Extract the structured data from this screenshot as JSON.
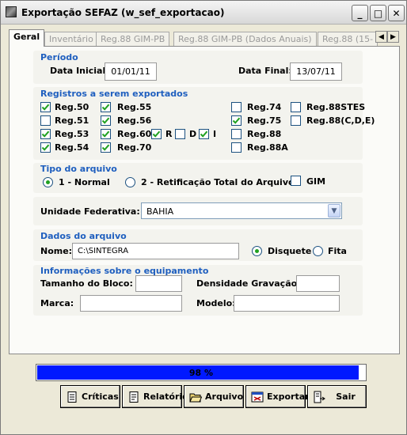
{
  "window": {
    "title": "Exportação SEFAZ (w_sef_exportacao)",
    "minimize": "_",
    "maximize": "□",
    "close": "✕"
  },
  "tabs": [
    {
      "label": "Geral",
      "active": true
    },
    {
      "label": "Inventário"
    },
    {
      "label": "Reg.88 GIM-PB"
    },
    {
      "label": "Reg.88 GIM-PB (Dados Anuais)"
    },
    {
      "label": "Reg.88 (15-"
    }
  ],
  "tab_scroll": {
    "left": "◀",
    "right": "▶"
  },
  "periodo": {
    "title": "Período",
    "data_inicial_label": "Data Inicial:",
    "data_inicial": "01/01/11",
    "data_final_label": "Data Final:",
    "data_final": "13/07/11"
  },
  "registros": {
    "title": "Registros a serem exportados",
    "items": [
      {
        "label": "Reg.50",
        "checked": true
      },
      {
        "label": "Reg.55",
        "checked": true
      },
      {
        "label": "Reg.74",
        "checked": false
      },
      {
        "label": "Reg.88STES",
        "checked": false
      },
      {
        "label": "Reg.51",
        "checked": false
      },
      {
        "label": "Reg.56",
        "checked": true
      },
      {
        "label": "Reg.75",
        "checked": true
      },
      {
        "label": "Reg.88(C,D,E)",
        "checked": false
      },
      {
        "label": "Reg.53",
        "checked": true
      },
      {
        "label": "Reg.60",
        "checked": true
      },
      {
        "label": "R",
        "checked": true
      },
      {
        "label": "D",
        "checked": false
      },
      {
        "label": "I",
        "checked": true
      },
      {
        "label": "Reg.88",
        "checked": false
      },
      {
        "label": "Reg.54",
        "checked": true
      },
      {
        "label": "Reg.70",
        "checked": true
      },
      {
        "label": "Reg.88A",
        "checked": false
      }
    ]
  },
  "tipo_arquivo": {
    "title": "Tipo do arquivo",
    "opt1": "1 - Normal",
    "opt2": "2 - Retificação Total do Arquivo",
    "gim": "GIM",
    "selected": "1 - Normal"
  },
  "uf": {
    "label": "Unidade Federativa:",
    "value": "BAHIA"
  },
  "dados_arquivo": {
    "title": "Dados do arquivo",
    "nome_label": "Nome:",
    "nome_value": "C:\\SINTEGRA",
    "disquete": "Disquete",
    "fita": "Fita",
    "selected": "Disquete"
  },
  "equipamento": {
    "title": "Informações sobre o equipamento",
    "tamanho_label": "Tamanho do Bloco:",
    "densidade_label": "Densidade Gravação:",
    "marca_label": "Marca:",
    "modelo_label": "Modelo:",
    "tamanho": "",
    "densidade": "",
    "marca": "",
    "modelo": ""
  },
  "progress": {
    "text": "98 %",
    "value": 0.98,
    "color": "#0019ff"
  },
  "buttons": {
    "criticas": "Críticas",
    "relatorios": "Relatórios",
    "arquivo": "Arquivo",
    "exportar": "Exportar",
    "sair": "Sair"
  },
  "colors": {
    "section_title": "#1f5fbf",
    "check": "#21a121"
  }
}
